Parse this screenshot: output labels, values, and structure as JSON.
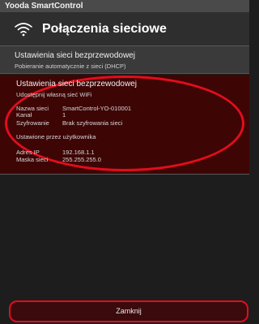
{
  "app": {
    "title": "Yooda SmartControl"
  },
  "header": {
    "title": "Połączenia sieciowe",
    "icon": "wifi-icon"
  },
  "client_network": {
    "title": "Ustawienia sieci bezprzewodowej",
    "subtitle": "Pobieranie automatycznie z sieci (DHCP)"
  },
  "hotspot": {
    "title": "Ustawienia sieci bezprzewodowej",
    "subtitle": "Udostępnij własną sieć WiFi",
    "network_name_label": "Nazwa sieci",
    "network_name_value": "SmartControl-YO-010001",
    "channel_label": "Kanał",
    "channel_value": "1",
    "encryption_label": "Szyfrowanie",
    "encryption_value": "Brak szyfrowania sieci",
    "user_set_label": "Ustawione przez użytkownika",
    "ip_label": "Adres IP",
    "ip_value": "192.168.1.1",
    "mask_label": "Maska sieci",
    "mask_value": "255.255.255.0"
  },
  "footer": {
    "close_label": "Zamknij"
  },
  "colors": {
    "accent": "#e20d1c",
    "highlight_bg": "#3e0505"
  }
}
